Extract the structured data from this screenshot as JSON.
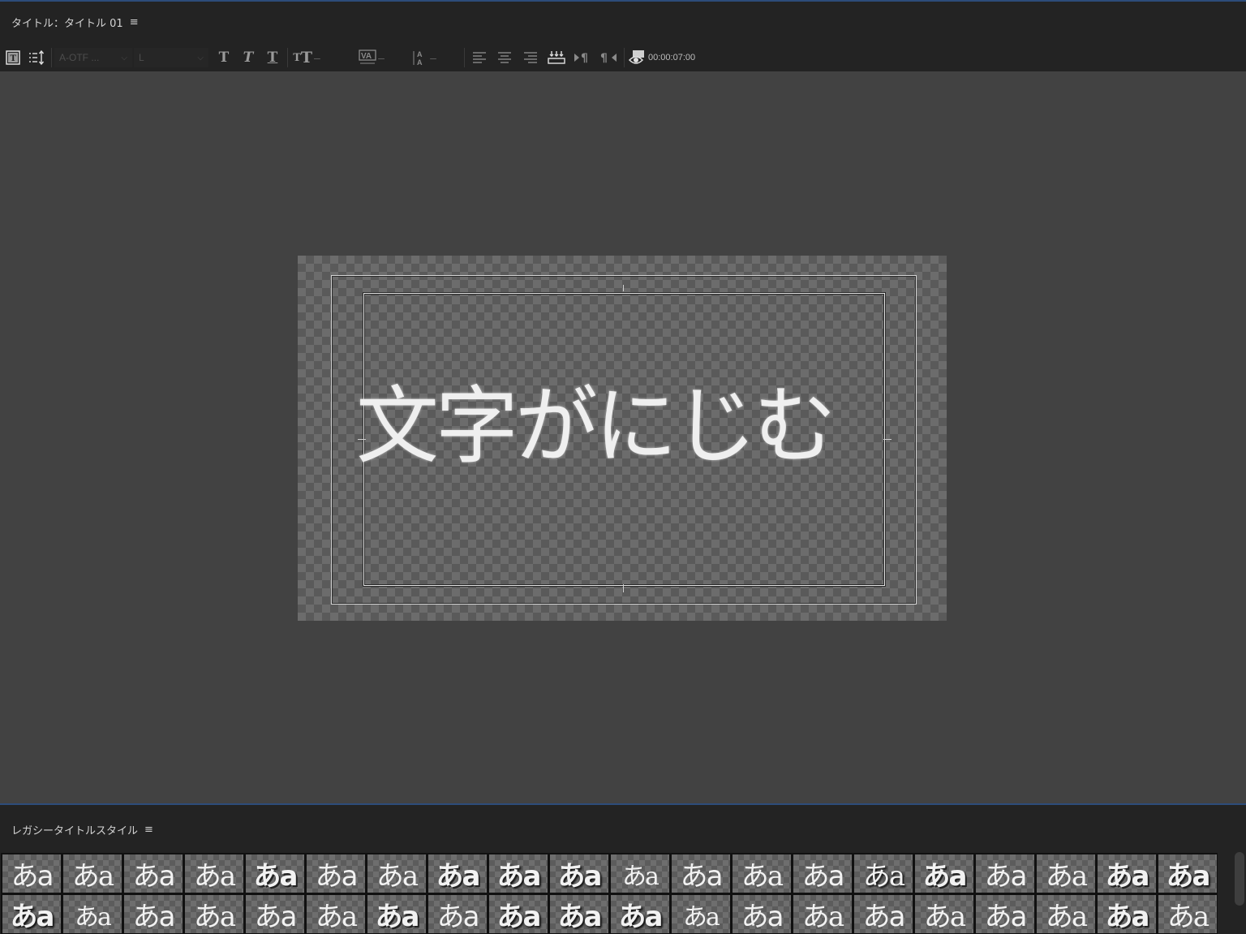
{
  "title_panel": {
    "header": "タイトル：タイトル 01",
    "menu_glyph": "≡"
  },
  "toolbar": {
    "font_family": "A-OTF ...",
    "font_style": "L",
    "combo_arrow": "⌵",
    "dash": "–",
    "timecode": "00:00:07:00"
  },
  "canvas": {
    "text": "文字がにじむ"
  },
  "styles_panel": {
    "header": "レガシータイトルスタイル",
    "menu_glyph": "≡",
    "swatch_label": "あa",
    "swatch_count": 40
  },
  "colors": {
    "panel_bg": "#232323",
    "monitor_bg": "#424242",
    "focus_border": "#2d4c7a"
  }
}
